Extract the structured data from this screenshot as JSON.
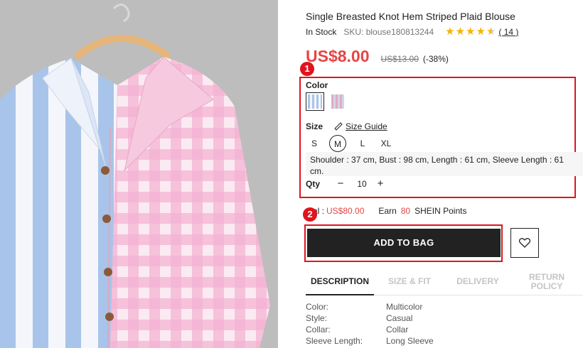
{
  "product": {
    "title": "Single Breasted Knot Hem Striped Plaid Blouse",
    "stock_status": "In Stock",
    "sku": "SKU: blouse180813244",
    "rating": 4.5,
    "review_count": "( 14 )",
    "price": "US$8.00",
    "original_price": "US$13.00",
    "discount": "(-38%)"
  },
  "options": {
    "color_label": "Color",
    "size_label": "Size",
    "size_guide": "Size Guide",
    "sizes": [
      "S",
      "M",
      "L",
      "XL"
    ],
    "selected_size": "M",
    "measurements": "Shoulder : 37 cm,  Bust : 98 cm,  Length : 61 cm,  Sleeve Length : 61 cm.",
    "qty_label": "Qty",
    "qty_minus": "−",
    "qty_plus": "+",
    "qty_value": "10"
  },
  "totals": {
    "total_label": "al :",
    "total_value": "US$80.00",
    "earn_label": "Earn",
    "earn_points": "80",
    "points_label": "SHEIN Points"
  },
  "actions": {
    "add_to_bag": "ADD TO BAG",
    "wishlist_icon": "heart-icon"
  },
  "tabs": [
    {
      "label": "DESCRIPTION",
      "active": true
    },
    {
      "label": "SIZE & FIT",
      "active": false
    },
    {
      "label": "DELIVERY",
      "active": false
    },
    {
      "label": "RETURN POLICY",
      "active": false
    }
  ],
  "specs": [
    {
      "key": "Color:",
      "value": "Multicolor"
    },
    {
      "key": "Style:",
      "value": "Casual"
    },
    {
      "key": "Collar:",
      "value": "Collar"
    },
    {
      "key": "Sleeve Length:",
      "value": "Long Sleeve"
    }
  ],
  "annotations": {
    "badge_1": "1",
    "badge_2": "2"
  },
  "colors": {
    "price_red": "#e64545",
    "annotation_red": "#e0141e",
    "star_gold": "#f5b400",
    "button_dark": "#222222"
  }
}
